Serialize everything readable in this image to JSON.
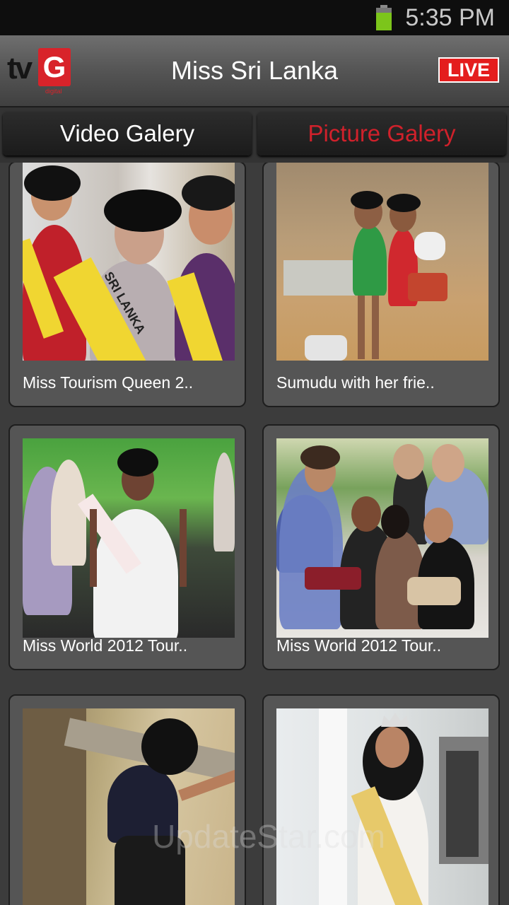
{
  "status": {
    "time": "5:35 PM"
  },
  "header": {
    "logo_tv": "tv",
    "logo_g": "G",
    "logo_sub": "digital",
    "title": "Miss Sri Lanka",
    "live_label": "LIVE"
  },
  "tabs": [
    {
      "label": "Video Galery",
      "selected": false
    },
    {
      "label": "Picture Galery",
      "selected": true
    }
  ],
  "gallery": [
    {
      "caption": "Miss Tourism Queen 2..",
      "sash": "SRI LANKA"
    },
    {
      "caption": "Sumudu with her frie.."
    },
    {
      "caption": "Miss World 2012 Tour.."
    },
    {
      "caption": "Miss World 2012 Tour.."
    },
    {
      "caption": ""
    },
    {
      "caption": ""
    }
  ],
  "watermark": "UpdateStar.com",
  "colors": {
    "accent": "#d0212b",
    "live": "#e41d1d",
    "battery": "#7cc51b"
  }
}
